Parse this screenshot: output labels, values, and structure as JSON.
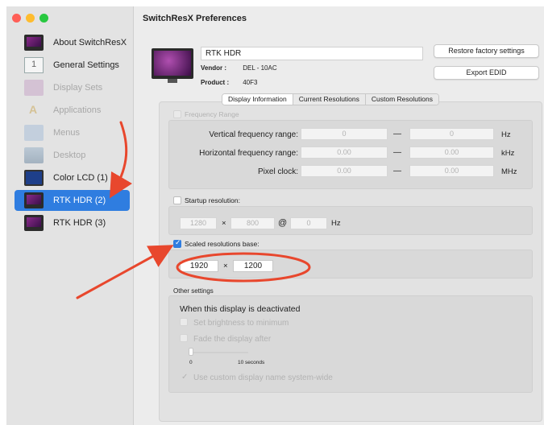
{
  "window": {
    "title": "SwitchResX Preferences"
  },
  "sidebar": {
    "items": [
      {
        "label": "About SwitchResX",
        "icon": "switchresx-monitor-icon",
        "state": "normal"
      },
      {
        "label": "General Settings",
        "icon": "general-settings-icon",
        "state": "normal"
      },
      {
        "label": "Display Sets",
        "icon": "display-sets-icon",
        "state": "disabled"
      },
      {
        "label": "Applications",
        "icon": "applications-icon",
        "state": "disabled"
      },
      {
        "label": "Menus",
        "icon": "menus-icon",
        "state": "disabled"
      },
      {
        "label": "Desktop",
        "icon": "desktop-icon",
        "state": "disabled"
      },
      {
        "label": "Color LCD (1)",
        "icon": "laptop-display-icon",
        "state": "normal"
      },
      {
        "label": "RTK HDR (2)",
        "icon": "display-icon",
        "state": "selected"
      },
      {
        "label": "RTK HDR (3)",
        "icon": "display-icon",
        "state": "normal"
      }
    ]
  },
  "display": {
    "name": "RTK HDR",
    "vendor_label": "Vendor :",
    "vendor_value": "DEL - 10AC",
    "product_label": "Product :",
    "product_value": "40F3",
    "restore_button": "Restore factory settings",
    "export_button": "Export EDID"
  },
  "tabs": [
    {
      "label": "Display Information",
      "active": true
    },
    {
      "label": "Current Resolutions",
      "active": false
    },
    {
      "label": "Custom Resolutions",
      "active": false
    }
  ],
  "frequency": {
    "checkbox_label": "Frequency Range",
    "vertical_label": "Vertical frequency range:",
    "vertical_min": "0",
    "vertical_max": "0",
    "vertical_unit": "Hz",
    "horizontal_label": "Horizontal frequency range:",
    "horizontal_min": "0.00",
    "horizontal_max": "0.00",
    "horizontal_unit": "kHz",
    "pixel_label": "Pixel clock:",
    "pixel_min": "0.00",
    "pixel_max": "0.00",
    "pixel_unit": "MHz",
    "dash": "—"
  },
  "startup": {
    "checkbox_label": "Startup resolution:",
    "width": "1280",
    "times": "×",
    "height": "800",
    "at": "@",
    "rate": "0",
    "unit": "Hz"
  },
  "scaled": {
    "checkbox_label": "Scaled resolutions base:",
    "checked": true,
    "width": "1920",
    "times": "×",
    "height": "1200"
  },
  "other": {
    "section_label": "Other settings",
    "deactivated_heading": "When this display is deactivated",
    "brightness_label": "Set brightness to minimum",
    "fade_label": "Fade the display after",
    "slider_min_label": "0",
    "slider_max_label": "10 seconds",
    "custom_name_label": "Use custom display name system-wide"
  },
  "colors": {
    "selection": "#2f7de0",
    "annotation": "#e8472d"
  }
}
